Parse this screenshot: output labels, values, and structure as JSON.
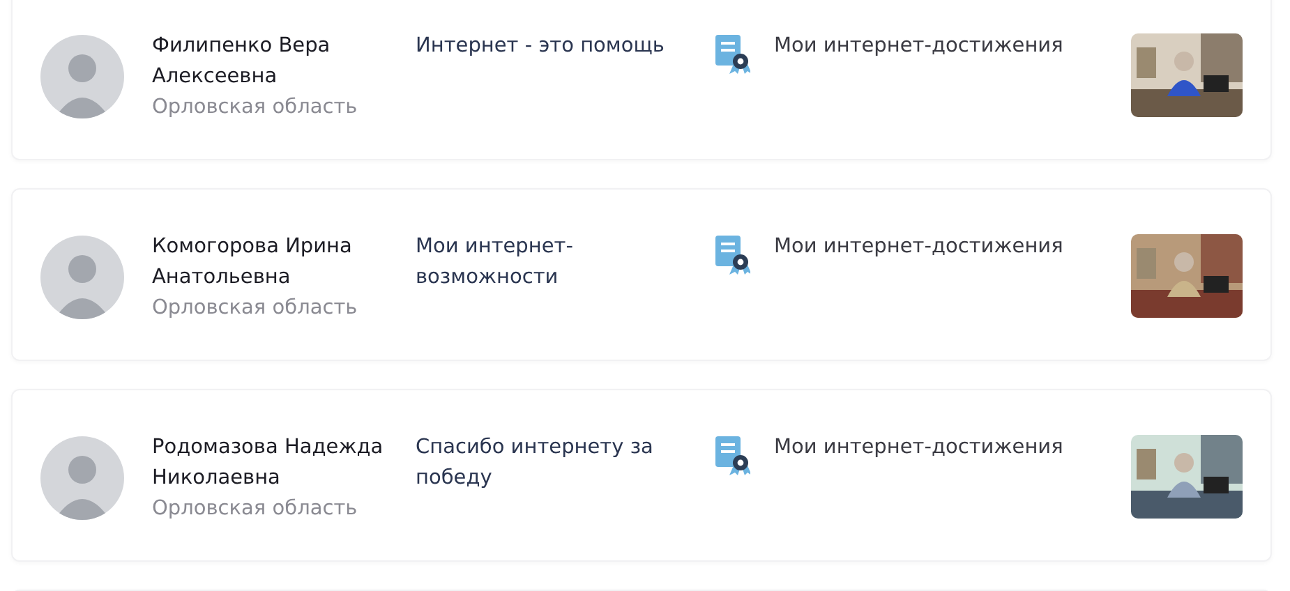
{
  "entries": [
    {
      "name": "Филипенко Вера Алексеевна",
      "region": "Орловская область",
      "title": "Интернет - это помощь",
      "category": "Мои интернет-достижения"
    },
    {
      "name": "Комогорова Ирина Анатольевна",
      "region": "Орловская область",
      "title": "Мои интернет-возможности",
      "category": "Мои интернет-достижения"
    },
    {
      "name": "Родомазова Надежда Николаевна",
      "region": "Орловская область",
      "title": "Спасибо интернету за победу",
      "category": "Мои интернет-достижения"
    }
  ]
}
